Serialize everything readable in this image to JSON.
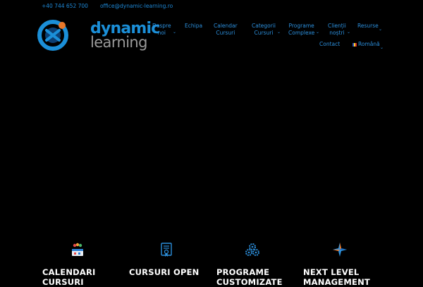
{
  "topbar": {
    "phone": "+40 744 652 700",
    "email": "office@dynamic-learning.ro"
  },
  "logo": {
    "word1": "dynamic",
    "word2": "learning"
  },
  "nav": [
    {
      "line1": "Despre",
      "line2": "noi",
      "has_dropdown": true
    },
    {
      "line1": "Echipa",
      "line2": "",
      "has_dropdown": false
    },
    {
      "line1": "Calendar",
      "line2": "Cursuri",
      "has_dropdown": false
    },
    {
      "line1": "Categorii",
      "line2": "Cursuri",
      "has_dropdown": true
    },
    {
      "line1": "Programe",
      "line2": "Complexe",
      "has_dropdown": true
    },
    {
      "line1": "Clienții",
      "line2": "noștri",
      "has_dropdown": true
    },
    {
      "line1": "Resurse",
      "line2": "",
      "has_dropdown": true
    },
    {
      "line1": "Contact",
      "line2": "",
      "has_dropdown": false
    },
    {
      "line1": "Română",
      "line2": "",
      "has_dropdown": true
    }
  ],
  "features": [
    {
      "icon": "calendar-people-icon",
      "line1": "CALENDARI",
      "line2": "CURSURI"
    },
    {
      "icon": "certificate-icon",
      "line1": "CURSURI OPEN",
      "line2": ""
    },
    {
      "icon": "gears-icon",
      "line1": "PROGRAME",
      "line2": "CUSTOMIZATE"
    },
    {
      "icon": "star-logo-icon",
      "line1": "NEXT LEVEL",
      "line2": "MANAGEMENT"
    }
  ],
  "colors": {
    "accent": "#1e88d6",
    "background": "#000000",
    "logo_grey": "#9a9a9a"
  }
}
